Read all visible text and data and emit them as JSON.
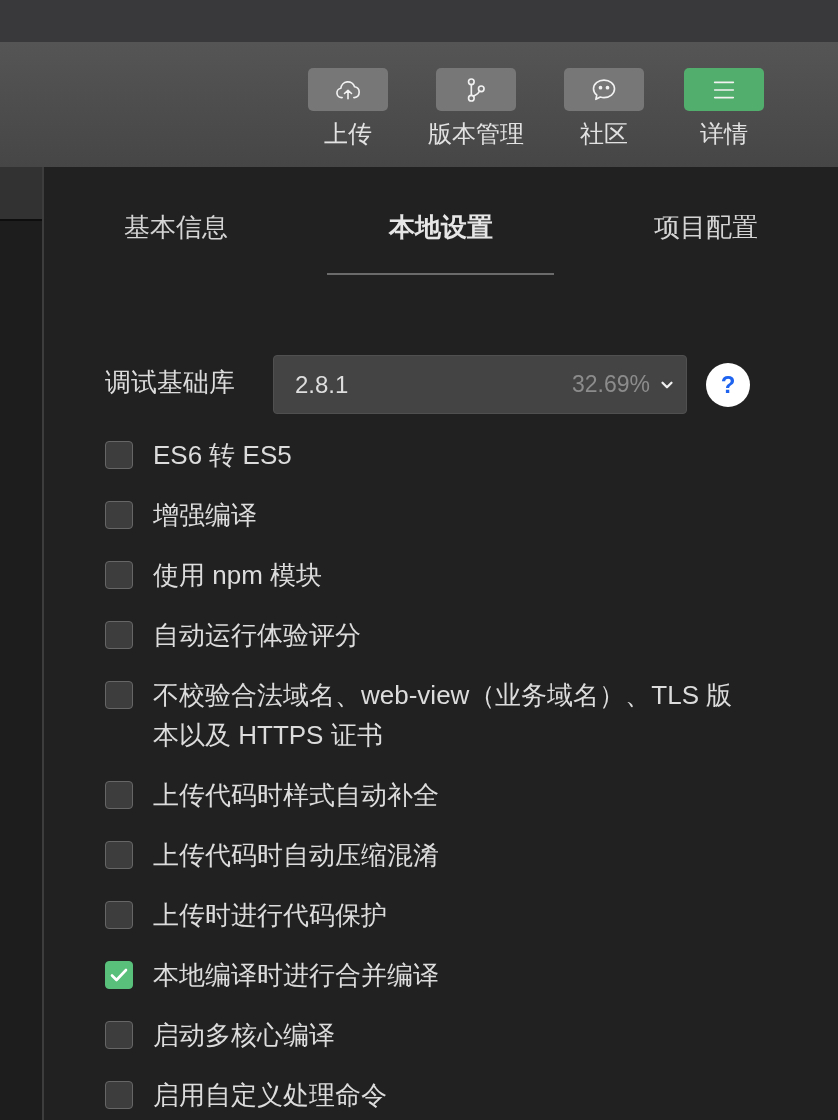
{
  "toolbar": {
    "buttons": [
      {
        "label": "上传",
        "selected": false
      },
      {
        "label": "版本管理",
        "selected": false
      },
      {
        "label": "社区",
        "selected": false
      },
      {
        "label": "详情",
        "selected": true
      }
    ]
  },
  "tabs": [
    {
      "label": "基本信息",
      "selected": false
    },
    {
      "label": "本地设置",
      "selected": true
    },
    {
      "label": "项目配置",
      "selected": false
    }
  ],
  "debug_library": {
    "label": "调试基础库",
    "value": "2.8.1",
    "share": "32.69%",
    "help": "?"
  },
  "options": [
    {
      "label": "ES6 转 ES5",
      "checked": false
    },
    {
      "label": "增强编译",
      "checked": false
    },
    {
      "label": "使用 npm 模块",
      "checked": false
    },
    {
      "label": "自动运行体验评分",
      "checked": false
    },
    {
      "label": "不校验合法域名、web-view（业务域名）、TLS 版本以及 HTTPS 证书",
      "checked": false
    },
    {
      "label": "上传代码时样式自动补全",
      "checked": false
    },
    {
      "label": "上传代码时自动压缩混淆",
      "checked": false
    },
    {
      "label": "上传时进行代码保护",
      "checked": false
    },
    {
      "label": "本地编译时进行合并编译",
      "checked": true
    },
    {
      "label": "启动多核心编译",
      "checked": false
    },
    {
      "label": "启用自定义处理命令",
      "checked": false
    }
  ]
}
